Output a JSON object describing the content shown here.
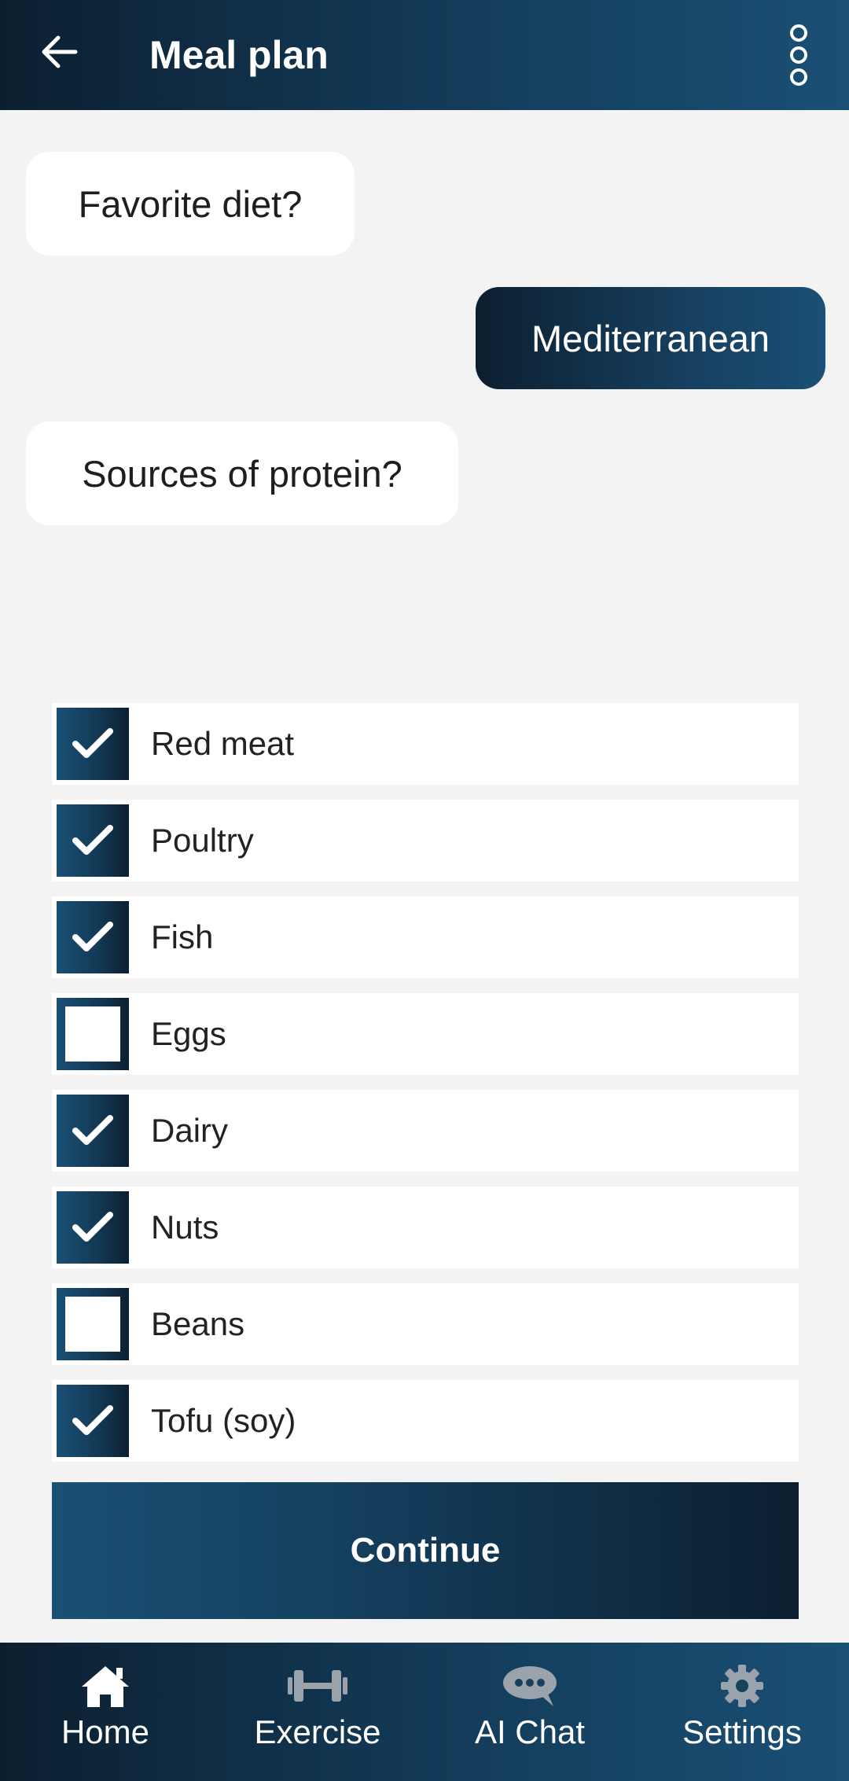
{
  "header": {
    "title": "Meal plan",
    "back_icon": "arrow-left-icon",
    "more_icon": "more-vertical-icon"
  },
  "chat": {
    "q1": "Favorite diet?",
    "a1": "Mediterranean",
    "q2": "Sources of protein?"
  },
  "options": [
    {
      "label": "Red meat",
      "checked": true
    },
    {
      "label": "Poultry",
      "checked": true
    },
    {
      "label": "Fish",
      "checked": true
    },
    {
      "label": "Eggs",
      "checked": false
    },
    {
      "label": "Dairy",
      "checked": true
    },
    {
      "label": "Nuts",
      "checked": true
    },
    {
      "label": "Beans",
      "checked": false
    },
    {
      "label": "Tofu (soy)",
      "checked": true
    }
  ],
  "continue_label": "Continue",
  "nav": {
    "home": {
      "label": "Home",
      "icon": "home-icon"
    },
    "exercise": {
      "label": "Exercise",
      "icon": "dumbbell-icon"
    },
    "ai_chat": {
      "label": "AI Chat",
      "icon": "chat-bubble-icon"
    },
    "settings": {
      "label": "Settings",
      "icon": "gear-icon"
    }
  },
  "colors": {
    "accent_dark": "#0c1f30",
    "accent_mid": "#133a57",
    "accent_light": "#1a5075",
    "background": "#f3f3f3",
    "nav_inactive_icon": "#9aa3ab"
  }
}
